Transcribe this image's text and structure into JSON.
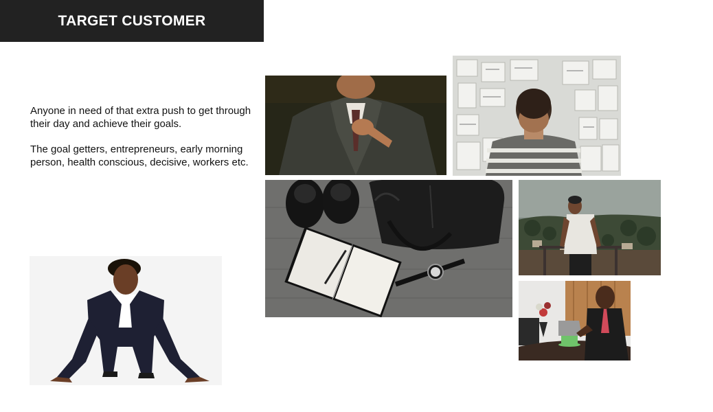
{
  "slide": {
    "title": "TARGET CUSTOMER",
    "paragraphs": [
      "Anyone in need of that extra push to get through their day and achieve their goals.",
      "The goal getters,  entrepreneurs, early morning person, health conscious, decisive, workers etc."
    ]
  },
  "images": {
    "businessman_tie": "businessman-adjusting-tie-photo",
    "idea_wall": "man-facing-idea-wall-photo",
    "desk_flatlay": "shoes-bag-notebook-watch-photo",
    "fitness": "man-exercising-outdoors-photo",
    "office_laptop": "man-at-laptop-with-coffee-photo",
    "runner": "woman-in-starting-position-photo"
  },
  "colors": {
    "title_bg": "#222222",
    "title_text": "#ffffff",
    "body_text": "#111111"
  }
}
